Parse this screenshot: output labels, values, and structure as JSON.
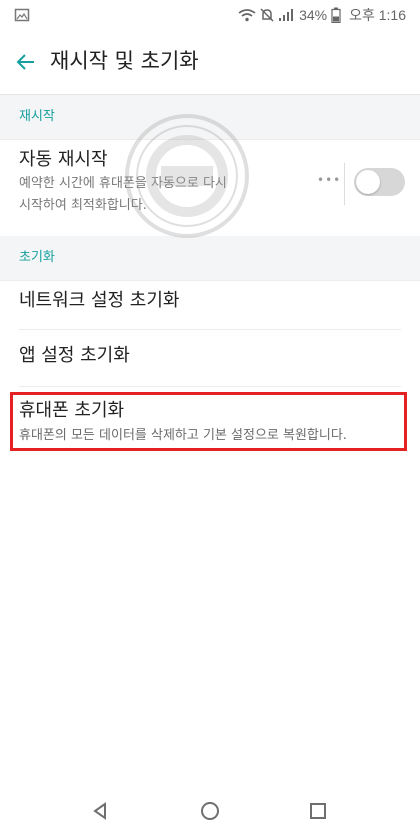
{
  "status_bar": {
    "battery_percent": "34%",
    "time": "오후 1:16",
    "left_icon": "gallery-icon",
    "icons": [
      "wifi-icon",
      "mute-icon",
      "signal-icon",
      "battery-icon"
    ]
  },
  "header": {
    "title": "재시작 및 초기화",
    "back_icon": "arrow-left-icon"
  },
  "sections": {
    "restart": {
      "label": "재시작",
      "items": [
        {
          "title": "자동 재시작",
          "description_line1": "예약한 시간에 휴대폰을 자동으로 다시",
          "description_line2": "시작하여 최적화합니다.",
          "toggle_enabled": false
        }
      ]
    },
    "reset": {
      "label": "초기화",
      "items": [
        {
          "title": "네트워크 설정 초기화"
        },
        {
          "title": "앱 설정 초기화"
        },
        {
          "title": "휴대폰 초기화",
          "description": "휴대폰의 모든 데이터를 삭제하고 기본 설정으로 복원합니다."
        }
      ]
    }
  },
  "navigation": {
    "buttons": [
      "back-triangle-icon",
      "home-circle-icon",
      "recents-square-icon"
    ]
  },
  "colors": {
    "accent": "#169f9f",
    "highlight": "#e52222",
    "section_background": "#f4f5f6"
  }
}
